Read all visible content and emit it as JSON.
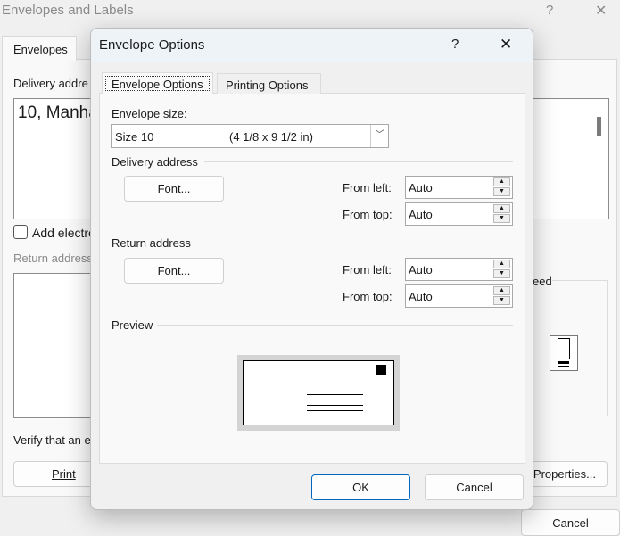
{
  "background": {
    "title": "Envelopes and Labels",
    "help": "?",
    "close": "✕",
    "tab": "Envelopes",
    "delivery_label": "Delivery addre",
    "delivery_text": "10, Manha",
    "add_electronic": "Add electro",
    "return_label": "Return address",
    "feed_label": "eed",
    "verify_text": "Verify that an e",
    "print": "Print",
    "properties": "Properties...",
    "cancel": "Cancel"
  },
  "modal": {
    "title": "Envelope Options",
    "help": "?",
    "close": "✕",
    "tabs": [
      {
        "label": "Envelope Options",
        "selected": true
      },
      {
        "label": "Printing Options",
        "selected": false
      }
    ],
    "envelope_size_label": "Envelope size:",
    "envelope_size_name": "Size 10",
    "envelope_size_dims": "(4 1/8 x 9 1/2 in)",
    "delivery": {
      "heading": "Delivery address",
      "font": "Font...",
      "from_left_label": "From left:",
      "from_left": "Auto",
      "from_top_label": "From top:",
      "from_top": "Auto"
    },
    "return": {
      "heading": "Return address",
      "font": "Font...",
      "from_left_label": "From left:",
      "from_left": "Auto",
      "from_top_label": "From top:",
      "from_top": "Auto"
    },
    "preview_label": "Preview",
    "ok": "OK",
    "cancel": "Cancel",
    "accent": "#0067c0"
  }
}
